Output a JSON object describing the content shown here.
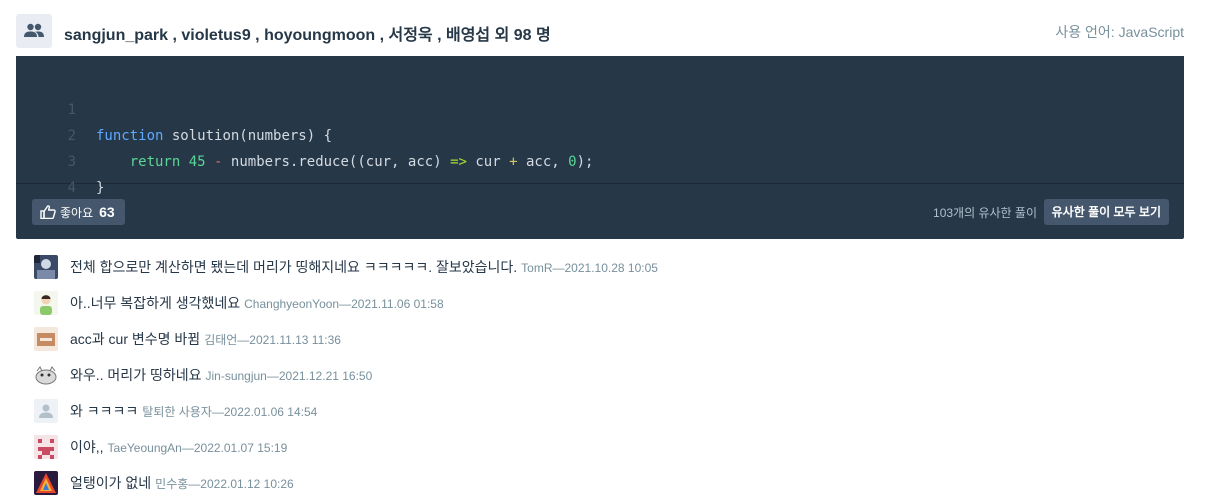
{
  "header": {
    "authors": "sangjun_park , violetus9 , hoyoungmoon , 서정욱 , 배영섭 외 98 명",
    "language_label": "사용 언어:",
    "language_value": "JavaScript"
  },
  "code": {
    "lines": [
      {
        "num": "1"
      },
      {
        "num": "2"
      },
      {
        "num": "3"
      },
      {
        "num": "4"
      }
    ],
    "tokens": {
      "l1_kw": "function",
      "l1_rest": " solution(numbers) {",
      "l2_indent": "    ",
      "l2_kw": "return",
      "l2_num": "45",
      "l2_op": "-",
      "l2_mid": "numbers.reduce((cur, acc)",
      "l2_arrow": "=>",
      "l2_cur": "cur",
      "l2_plus": "+",
      "l2_acc": "acc,",
      "l2_zero": "0",
      "l2_end": ");",
      "l3": "}"
    }
  },
  "footer": {
    "like_label": "좋아요",
    "like_count": "63",
    "similar_count": "103개의 유사한 풀이",
    "similar_button": "유사한 풀이 모두 보기"
  },
  "comments": [
    {
      "text": "전체 합으로만 계산하면 됐는데 머리가 띵해지네요 ㅋㅋㅋㅋㅋ. 잘보았습니다.",
      "meta": "TomR—2021.10.28 10:05"
    },
    {
      "text": "아..너무 복잡하게 생각했네요",
      "meta": "ChanghyeonYoon—2021.11.06 01:58"
    },
    {
      "text": "acc과 cur 변수명 바뀜",
      "meta": "김태언—2021.11.13 11:36"
    },
    {
      "text": "와우.. 머리가 띵하네요",
      "meta": "Jin-sungjun—2021.12.21 16:50"
    },
    {
      "text": "와 ㅋㅋㅋㅋ",
      "meta": "탈퇴한 사용자—2022.01.06 14:54"
    },
    {
      "text": "이야,,",
      "meta": "TaeYeoungAn—2022.01.07 15:19"
    },
    {
      "text": "얼탱이가 없네",
      "meta": "민수홍—2022.01.12 10:26"
    }
  ],
  "icons": {
    "group": "group-icon",
    "like": "thumbs-up-icon"
  }
}
